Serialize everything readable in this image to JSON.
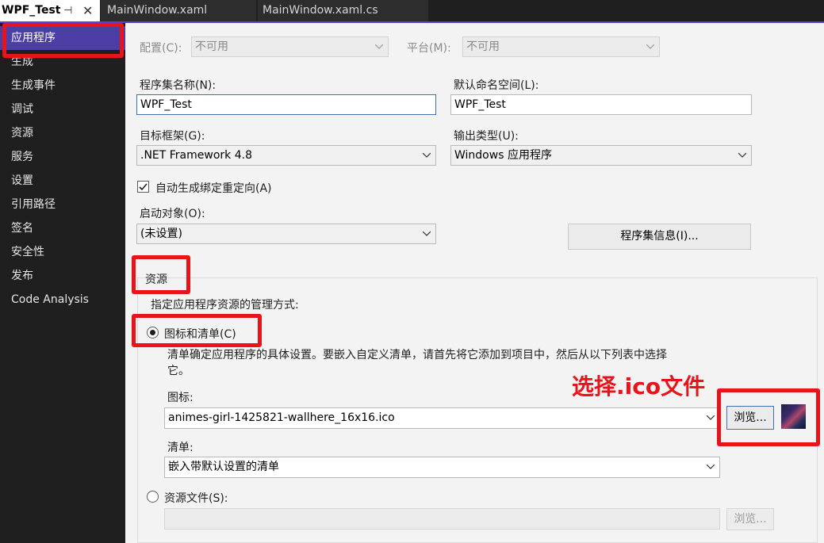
{
  "tabs": [
    {
      "label": "WPF_Test",
      "active": true
    },
    {
      "label": "MainWindow.xaml",
      "active": false
    },
    {
      "label": "MainWindow.xaml.cs",
      "active": false
    }
  ],
  "tab_icons": {
    "pin": "pin-icon",
    "close": "close-icon"
  },
  "sidebar": {
    "items": [
      {
        "label": "应用程序",
        "active": true
      },
      {
        "label": "生成"
      },
      {
        "label": "生成事件"
      },
      {
        "label": "调试"
      },
      {
        "label": "资源"
      },
      {
        "label": "服务"
      },
      {
        "label": "设置"
      },
      {
        "label": "引用路径"
      },
      {
        "label": "签名"
      },
      {
        "label": "安全性"
      },
      {
        "label": "发布"
      },
      {
        "label": "Code Analysis"
      }
    ]
  },
  "config": {
    "label": "配置(C):",
    "value": "不可用"
  },
  "platform": {
    "label": "平台(M):",
    "value": "不可用"
  },
  "assembly_name": {
    "label": "程序集名称(N):",
    "value": "WPF_Test"
  },
  "default_namespace": {
    "label": "默认命名空间(L):",
    "value": "WPF_Test"
  },
  "target_framework": {
    "label": "目标框架(G):",
    "value": ".NET Framework 4.8"
  },
  "output_type": {
    "label": "输出类型(U):",
    "value": "Windows 应用程序"
  },
  "auto_binding": {
    "label": "自动生成绑定重定向(A)",
    "checked": true
  },
  "startup_object": {
    "label": "启动对象(O):",
    "value": "(未设置)"
  },
  "assembly_info_button": "程序集信息(I)...",
  "resources": {
    "heading": "资源",
    "description": "指定应用程序资源的管理方式:",
    "icon_manifest_radio": "图标和清单(C)",
    "icon_manifest_desc_line1": "清单确定应用程序的具体设置。要嵌入自定义清单，请首先将它添加到项目中，然后从以下列表中选择",
    "icon_manifest_desc_line2": "它。",
    "icon_label": "图标:",
    "icon_value": "animes-girl-1425821-wallhere_16x16.ico",
    "browse_button": "浏览...",
    "manifest_label": "清单:",
    "manifest_value": "嵌入带默认设置的清单",
    "resource_file_radio": "资源文件(S):",
    "resource_file_value": "",
    "browse_button_disabled": "浏览..."
  },
  "annotation": "选择.ico文件",
  "colors": {
    "accent": "#5d3fd3",
    "highlight": "#e8141c",
    "sidebar_bg": "#1f1f1f",
    "panel_bg": "#f3f3f3"
  }
}
